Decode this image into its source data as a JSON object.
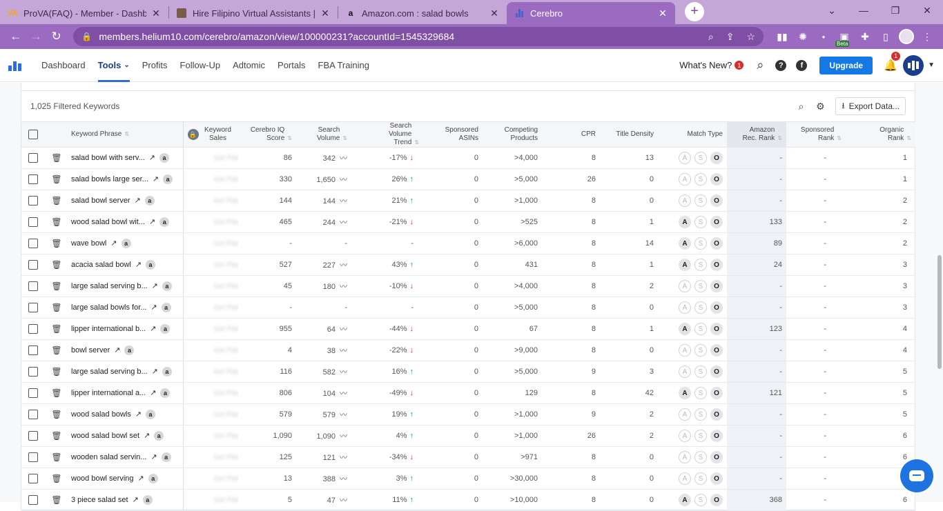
{
  "browser": {
    "tabs": [
      {
        "title": "ProVA(FAQ) - Member - Dashboa",
        "favicon": "VA"
      },
      {
        "title": "Hire Filipino Virtual Assistants | Fi",
        "favicon": "image-icon"
      },
      {
        "title": "Amazon.com : salad bowls",
        "favicon": "a"
      },
      {
        "title": "Cerebro",
        "favicon": "helium10-logo",
        "active": true
      }
    ],
    "url": "members.helium10.com/cerebro/amazon/view/100000231?accountId=1545329684",
    "beta_label": "Beta"
  },
  "app": {
    "nav": [
      "Dashboard",
      "Tools",
      "Profits",
      "Follow-Up",
      "Adtomic",
      "Portals",
      "FBA Training"
    ],
    "active_nav": "Tools",
    "whats_new": "What's New?",
    "whats_new_count": "1",
    "upgrade_label": "Upgrade",
    "notification_count": "1"
  },
  "toolbar": {
    "filtered_label": "1,025 Filtered Keywords",
    "export_label": "Export Data..."
  },
  "table": {
    "headers": {
      "keyword": "Keyword Phrase",
      "kw_sales": "Keyword Sales",
      "iq": "Cerebro IQ Score",
      "volume": "Search Volume",
      "trend": "Search Volume Trend",
      "sponsored_asins": "Sponsored ASINs",
      "competing": "Competing Products",
      "cpr": "CPR",
      "title_density": "Title Density",
      "match_type": "Match Type",
      "amz_rank": "Amazon Rec. Rank",
      "sponsored_rank": "Sponsored Rank",
      "organic_rank": "Organic Rank"
    },
    "rows": [
      {
        "kw": "salad bowl with serv...",
        "iq": "86",
        "vol": "342",
        "trend": "-17%",
        "dir": "down",
        "asins": "0",
        "comp": ">4,000",
        "cpr": "8",
        "td": "13",
        "match": [
          false,
          false,
          true
        ],
        "amz": "-",
        "spons": "-",
        "org": "1"
      },
      {
        "kw": "salad bowls large ser...",
        "iq": "330",
        "vol": "1,650",
        "trend": "26%",
        "dir": "up",
        "asins": "0",
        "comp": ">5,000",
        "cpr": "26",
        "td": "0",
        "match": [
          false,
          false,
          true
        ],
        "amz": "-",
        "spons": "-",
        "org": "1"
      },
      {
        "kw": "salad bowl server",
        "iq": "144",
        "vol": "144",
        "trend": "21%",
        "dir": "up",
        "asins": "0",
        "comp": ">1,000",
        "cpr": "8",
        "td": "0",
        "match": [
          false,
          false,
          true
        ],
        "amz": "-",
        "spons": "-",
        "org": "2"
      },
      {
        "kw": "wood salad bowl wit...",
        "iq": "465",
        "vol": "244",
        "trend": "-21%",
        "dir": "down",
        "asins": "0",
        "comp": ">525",
        "cpr": "8",
        "td": "1",
        "match": [
          true,
          false,
          true
        ],
        "amz": "133",
        "spons": "-",
        "org": "2"
      },
      {
        "kw": "wave bowl",
        "iq": "-",
        "vol": "-",
        "trend": "-",
        "dir": "",
        "asins": "0",
        "comp": ">6,000",
        "cpr": "8",
        "td": "14",
        "match": [
          true,
          false,
          true
        ],
        "amz": "89",
        "spons": "-",
        "org": "2"
      },
      {
        "kw": "acacia salad bowl",
        "iq": "527",
        "vol": "227",
        "trend": "43%",
        "dir": "up",
        "asins": "0",
        "comp": "431",
        "cpr": "8",
        "td": "1",
        "match": [
          true,
          false,
          true
        ],
        "amz": "24",
        "spons": "-",
        "org": "3"
      },
      {
        "kw": "large salad serving b...",
        "iq": "45",
        "vol": "180",
        "trend": "-10%",
        "dir": "down",
        "asins": "0",
        "comp": ">4,000",
        "cpr": "8",
        "td": "2",
        "match": [
          false,
          false,
          true
        ],
        "amz": "-",
        "spons": "-",
        "org": "3"
      },
      {
        "kw": "large salad bowls for...",
        "iq": "-",
        "vol": "-",
        "trend": "-",
        "dir": "",
        "asins": "0",
        "comp": ">5,000",
        "cpr": "8",
        "td": "0",
        "match": [
          false,
          false,
          true
        ],
        "amz": "-",
        "spons": "-",
        "org": "3"
      },
      {
        "kw": "lipper international b...",
        "iq": "955",
        "vol": "64",
        "trend": "-44%",
        "dir": "down",
        "asins": "0",
        "comp": "67",
        "cpr": "8",
        "td": "1",
        "match": [
          true,
          false,
          true
        ],
        "amz": "123",
        "spons": "-",
        "org": "4"
      },
      {
        "kw": "bowl server",
        "iq": "4",
        "vol": "38",
        "trend": "-22%",
        "dir": "down",
        "asins": "0",
        "comp": ">9,000",
        "cpr": "8",
        "td": "0",
        "match": [
          false,
          false,
          true
        ],
        "amz": "-",
        "spons": "-",
        "org": "4"
      },
      {
        "kw": "large salad serving b...",
        "iq": "116",
        "vol": "582",
        "trend": "16%",
        "dir": "up",
        "asins": "0",
        "comp": ">5,000",
        "cpr": "9",
        "td": "3",
        "match": [
          false,
          false,
          true
        ],
        "amz": "-",
        "spons": "-",
        "org": "5"
      },
      {
        "kw": "lipper international a...",
        "iq": "806",
        "vol": "104",
        "trend": "-49%",
        "dir": "down",
        "asins": "0",
        "comp": "129",
        "cpr": "8",
        "td": "42",
        "match": [
          true,
          false,
          true
        ],
        "amz": "121",
        "spons": "-",
        "org": "5"
      },
      {
        "kw": "wood salad bowls",
        "iq": "579",
        "vol": "579",
        "trend": "19%",
        "dir": "up",
        "asins": "0",
        "comp": ">1,000",
        "cpr": "9",
        "td": "2",
        "match": [
          false,
          false,
          true
        ],
        "amz": "-",
        "spons": "-",
        "org": "5"
      },
      {
        "kw": "wood salad bowl set",
        "iq": "1,090",
        "vol": "1,090",
        "trend": "4%",
        "dir": "up",
        "asins": "0",
        "comp": ">1,000",
        "cpr": "26",
        "td": "2",
        "match": [
          false,
          false,
          true
        ],
        "amz": "-",
        "spons": "-",
        "org": "6"
      },
      {
        "kw": "wooden salad servin...",
        "iq": "125",
        "vol": "121",
        "trend": "-34%",
        "dir": "down",
        "asins": "0",
        "comp": ">971",
        "cpr": "8",
        "td": "0",
        "match": [
          false,
          false,
          true
        ],
        "amz": "-",
        "spons": "-",
        "org": "6"
      },
      {
        "kw": "wood bowl serving",
        "iq": "13",
        "vol": "388",
        "trend": "3%",
        "dir": "up",
        "asins": "0",
        "comp": ">30,000",
        "cpr": "8",
        "td": "0",
        "match": [
          false,
          false,
          true
        ],
        "amz": "-",
        "spons": "-",
        "org": "6"
      },
      {
        "kw": "3 piece salad set",
        "iq": "5",
        "vol": "47",
        "trend": "11%",
        "dir": "up",
        "asins": "0",
        "comp": ">10,000",
        "cpr": "8",
        "td": "0",
        "match": [
          true,
          false,
          true
        ],
        "amz": "368",
        "spons": "-",
        "org": "6"
      }
    ],
    "blurred_sales": "Get Plan"
  }
}
